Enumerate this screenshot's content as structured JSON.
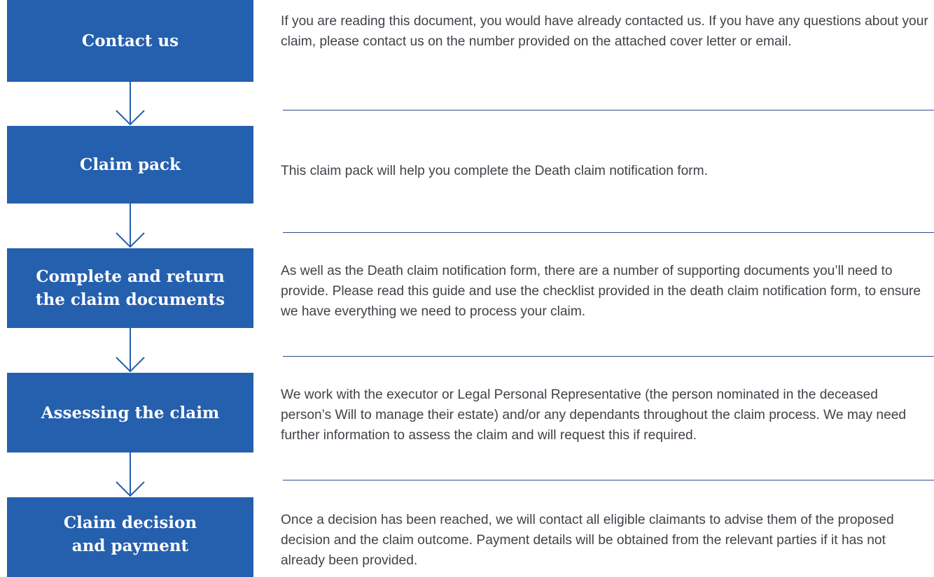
{
  "steps": [
    {
      "title": "Contact us",
      "description": "If you are reading this document, you would have already contacted us. If you have any questions about your claim, please contact us on the number provided on the attached cover letter or email."
    },
    {
      "title": "Claim pack",
      "description": "This claim pack will help you complete the Death claim notification form."
    },
    {
      "title_lines": [
        "Complete and return",
        "the claim documents"
      ],
      "description": "As well as the Death claim notification form, there are a number of supporting documents you’ll need to provide. Please read this guide and use the checklist provided in the death claim notification form, to ensure we have everything we need to process your claim."
    },
    {
      "title": "Assessing the claim",
      "description": "We work with the executor or Legal Personal Representative (the person nominated in the deceased person’s Will to manage their estate) and/or any dependants throughout the claim process. We may need further information to assess the claim and will request this if required."
    },
    {
      "title_lines": [
        "Claim decision",
        "and payment"
      ],
      "description": "Once a decision has been reached, we will contact all eligible claimants to advise them of the proposed decision and the claim outcome. Payment details will be obtained from the relevant parties if it has not already been provided."
    }
  ],
  "colors": {
    "box_fill": "#2560ae",
    "box_text": "#ffffff",
    "arrow": "#2560ae",
    "divider": "#2c4f86",
    "body_text": "#3f4349"
  },
  "icons": {
    "connector": "chevron-down-arrow-icon"
  }
}
